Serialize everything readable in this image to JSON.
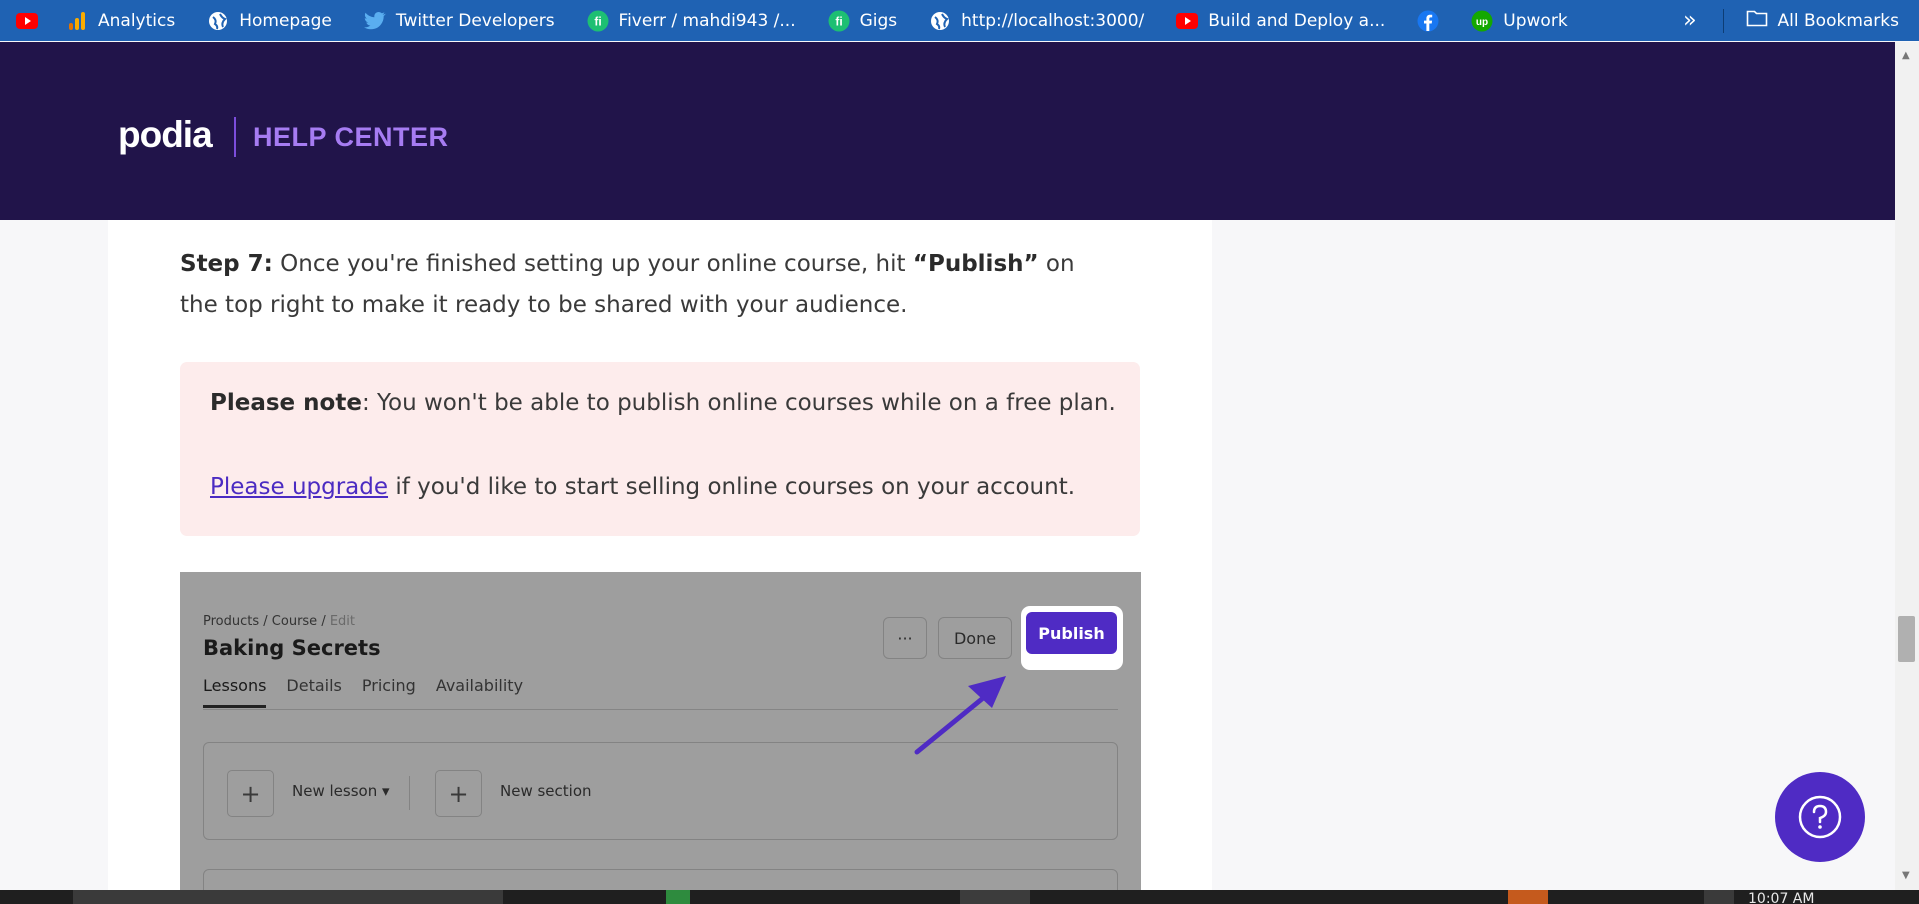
{
  "bookmarks": [
    {
      "label": "",
      "icon": "youtube-icon"
    },
    {
      "label": "Analytics",
      "icon": "analytics-icon"
    },
    {
      "label": "Homepage",
      "icon": "globe-icon"
    },
    {
      "label": "Twitter Developers",
      "icon": "twitter-icon"
    },
    {
      "label": "Fiverr / mahdi943 /...",
      "icon": "fiverr-icon"
    },
    {
      "label": "Gigs",
      "icon": "fiverr-icon"
    },
    {
      "label": "http://localhost:3000/",
      "icon": "globe-icon"
    },
    {
      "label": "Build and Deploy a...",
      "icon": "youtube-icon"
    },
    {
      "label": "",
      "icon": "facebook-icon"
    },
    {
      "label": "Upwork",
      "icon": "upwork-icon"
    }
  ],
  "bookmarks_overflow": "»",
  "all_bookmarks_label": "All Bookmarks",
  "header": {
    "logo": "podia",
    "title": "HELP CENTER"
  },
  "article": {
    "step_label": "Step 7:",
    "step_text_1": " Once you're finished setting up your online course, hit ",
    "step_publish": "“Publish”",
    "step_text_2": " on the top right to make it ready to be shared with your audience.",
    "note_label": "Please note",
    "note_text": ": You won't be able to publish online courses while on a free plan.",
    "upgrade_link": "Please upgrade",
    "upgrade_text": " if you'd like to start selling online courses on your account."
  },
  "screenshot": {
    "crumb_products": "Products",
    "crumb_sep1": " / ",
    "crumb_course": "Course",
    "crumb_sep2": " / ",
    "crumb_edit": "Edit",
    "title": "Baking Secrets",
    "tabs": [
      "Lessons",
      "Details",
      "Pricing",
      "Availability"
    ],
    "more_label": "···",
    "done_label": "Done",
    "publish_label": "Publish",
    "new_lesson_label": "New lesson ▾",
    "new_section_label": "New section",
    "plus_symbol": "+"
  },
  "colors": {
    "bookmark_bar": "#1f62b3",
    "header_bg": "#21144a",
    "accent": "#4f2bc4",
    "note_bg": "#fdecec"
  },
  "taskbar_clock": "10:07 AM"
}
